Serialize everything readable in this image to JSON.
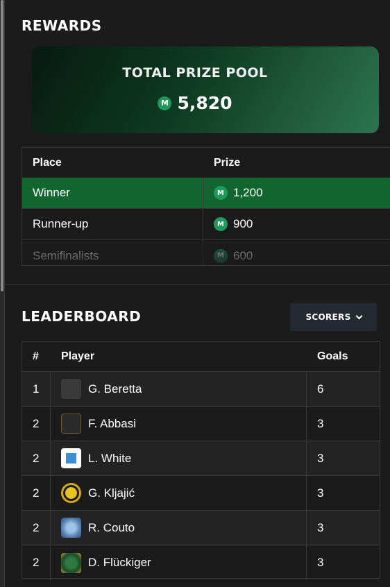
{
  "rewards": {
    "title": "REWARDS",
    "prize_pool": {
      "label": "TOTAL PRIZE POOL",
      "amount": "5,820",
      "coin_symbol": "M"
    },
    "table": {
      "headers": {
        "place": "Place",
        "prize": "Prize"
      },
      "rows": [
        {
          "place": "Winner",
          "prize": "1,200"
        },
        {
          "place": "Runner-up",
          "prize": "900"
        },
        {
          "place": "Semifinalists",
          "prize": "600"
        }
      ]
    }
  },
  "leaderboard": {
    "title": "LEADERBOARD",
    "filter": {
      "label": "SCORERS",
      "icon": "chevron-down-icon"
    },
    "headers": {
      "rank": "#",
      "player": "Player",
      "goals": "Goals"
    },
    "rows": [
      {
        "rank": "1",
        "player": "G. Beretta",
        "goals": "6",
        "badge_color": "#3a3a3a"
      },
      {
        "rank": "2",
        "player": "F. Abbasi",
        "goals": "3",
        "badge_color": "#2b2b2b"
      },
      {
        "rank": "2",
        "player": "L. White",
        "goals": "3",
        "badge_color": "#ffffff"
      },
      {
        "rank": "2",
        "player": "G. Kljajić",
        "goals": "3",
        "badge_color": "#d4b01a"
      },
      {
        "rank": "2",
        "player": "R. Couto",
        "goals": "3",
        "badge_color": "#5d88b8"
      },
      {
        "rank": "2",
        "player": "D. Flückiger",
        "goals": "3",
        "badge_color": "#1e4a2a"
      }
    ]
  },
  "colors": {
    "background": "#1b1b1c",
    "winner_row": "#11672f",
    "coin": "#1f9a5a",
    "button": "#252932"
  }
}
